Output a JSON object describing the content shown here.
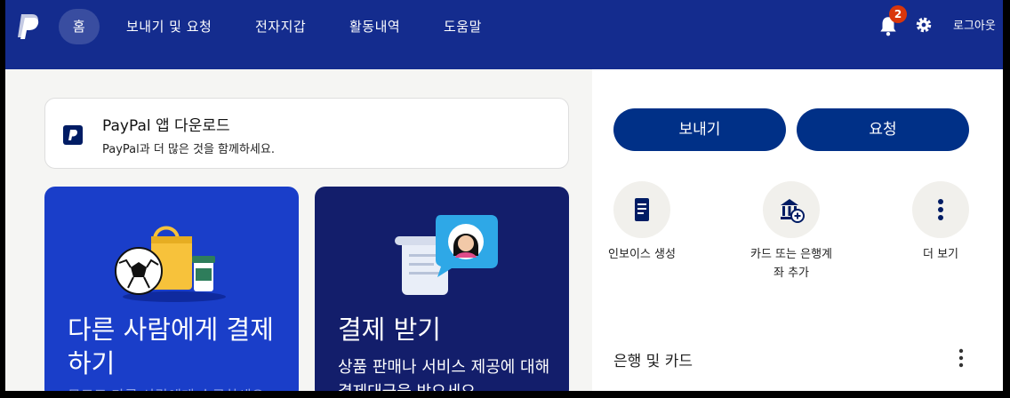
{
  "colors": {
    "nav_bg": "#142c8e",
    "primary_button": "#003087",
    "card_blue": "#1a3ec9",
    "card_navy": "#131e6b",
    "badge": "#d9360b"
  },
  "nav": {
    "logo_icon": "paypal-logo",
    "items": [
      {
        "label": "홈",
        "active": true
      },
      {
        "label": "보내기 및 요청"
      },
      {
        "label": "전자지갑"
      },
      {
        "label": "활동내역"
      },
      {
        "label": "도움말"
      }
    ],
    "notifications_count": "2",
    "settings_icon": "gear-icon",
    "logout_label": "로그아웃"
  },
  "promo": {
    "title_prefix": "PayPal",
    "title_suffix": " 앱 다운로드",
    "subtitle": "PayPal과 더 많은 것을 함께하세요."
  },
  "cards": [
    {
      "title": "다른 사람에게 결제하기",
      "desc_faded": "무료로 다른 사람에게 송금하세요"
    },
    {
      "title": "결제 받기",
      "desc": "상품 판매나 서비스 제공에 대해 결제대금을 받으세요."
    }
  ],
  "actions": {
    "send_label": "보내기",
    "request_label": "요청",
    "quick": [
      {
        "icon": "invoice-icon",
        "label": "인보이스 생성"
      },
      {
        "icon": "bank-add-icon",
        "label": "카드 또는 은행계좌 추가"
      },
      {
        "icon": "more-vertical-icon",
        "label": "더 보기"
      }
    ]
  },
  "bank_section": {
    "title": "은행 및 카드"
  }
}
